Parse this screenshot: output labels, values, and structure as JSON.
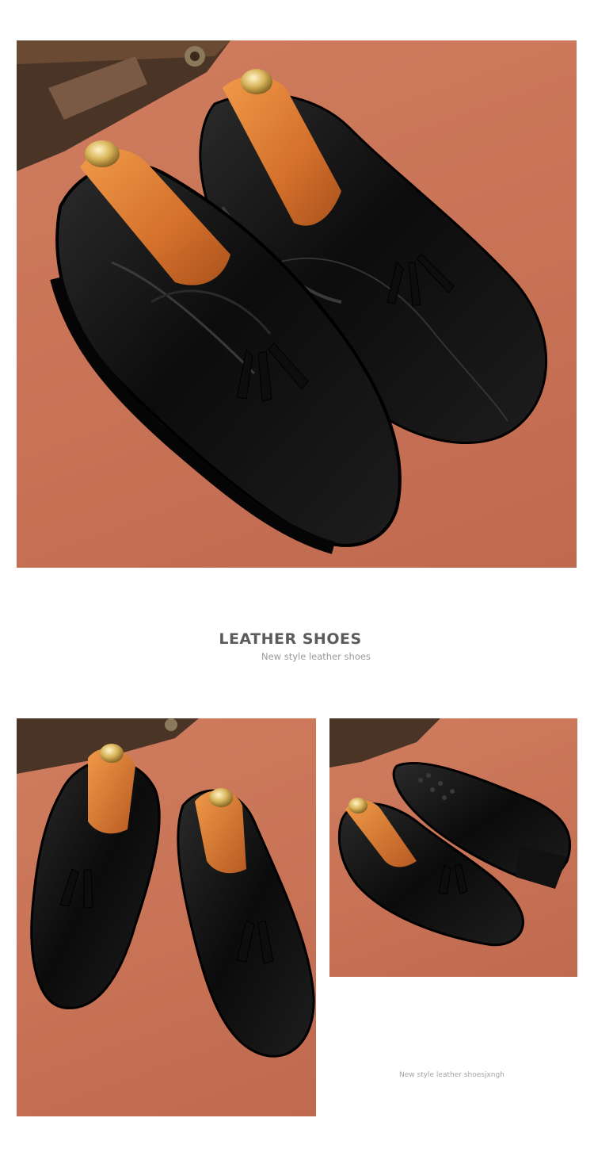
{
  "heading": {
    "title": "LEATHER SHOES",
    "subtitle": "New style leather shoes"
  },
  "caption": "New style leather shoesjxngh",
  "photos": [
    {
      "name": "hero-photo",
      "icon": "shoe-pair-photo"
    },
    {
      "name": "left-detail-photo",
      "icon": "shoe-pair-photo"
    },
    {
      "name": "right-detail-photo",
      "icon": "shoe-pair-photo"
    }
  ],
  "colors": {
    "background": "#c87256",
    "leather": "#111111",
    "shoe_tree": "#d87a35",
    "text_dark": "#5b5b5b",
    "text_light": "#9a9a9a"
  }
}
